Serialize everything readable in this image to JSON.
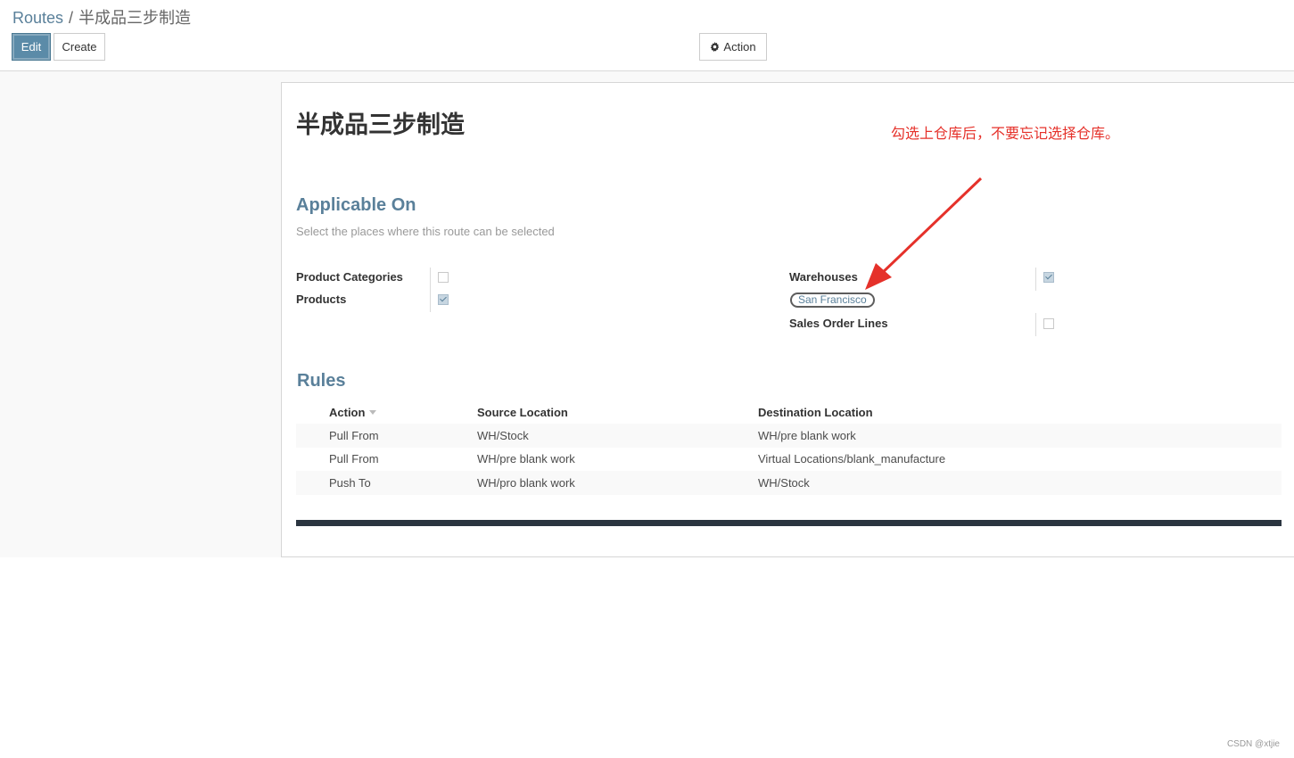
{
  "breadcrumb": {
    "parent": "Routes",
    "separator": "/",
    "current": "半成品三步制造"
  },
  "toolbar": {
    "edit_label": "Edit",
    "create_label": "Create",
    "action_label": "Action"
  },
  "record": {
    "title": "半成品三步制造"
  },
  "annotation": {
    "text": "勾选上仓库后，不要忘记选择仓库。",
    "color": "#e5312a"
  },
  "applicable": {
    "title": "Applicable On",
    "hint": "Select the places where this route can be selected",
    "product_categories": {
      "label": "Product Categories",
      "checked": false
    },
    "products": {
      "label": "Products",
      "checked": true
    },
    "warehouses": {
      "label": "Warehouses",
      "checked": true,
      "tag": "San Francisco"
    },
    "sales_order_lines": {
      "label": "Sales Order Lines",
      "checked": false
    }
  },
  "rules": {
    "title": "Rules",
    "columns": [
      "Action",
      "Source Location",
      "Destination Location"
    ],
    "rows": [
      [
        "Pull From",
        "WH/Stock",
        "WH/pre blank work"
      ],
      [
        "Pull From",
        "WH/pre blank work",
        "Virtual Locations/blank_manufacture"
      ],
      [
        "Push To",
        "WH/pro blank work",
        "WH/Stock"
      ]
    ]
  },
  "watermark": "CSDN @xtjie",
  "colors": {
    "accent": "#5a809a",
    "edit_button": "#5b8ba8"
  }
}
